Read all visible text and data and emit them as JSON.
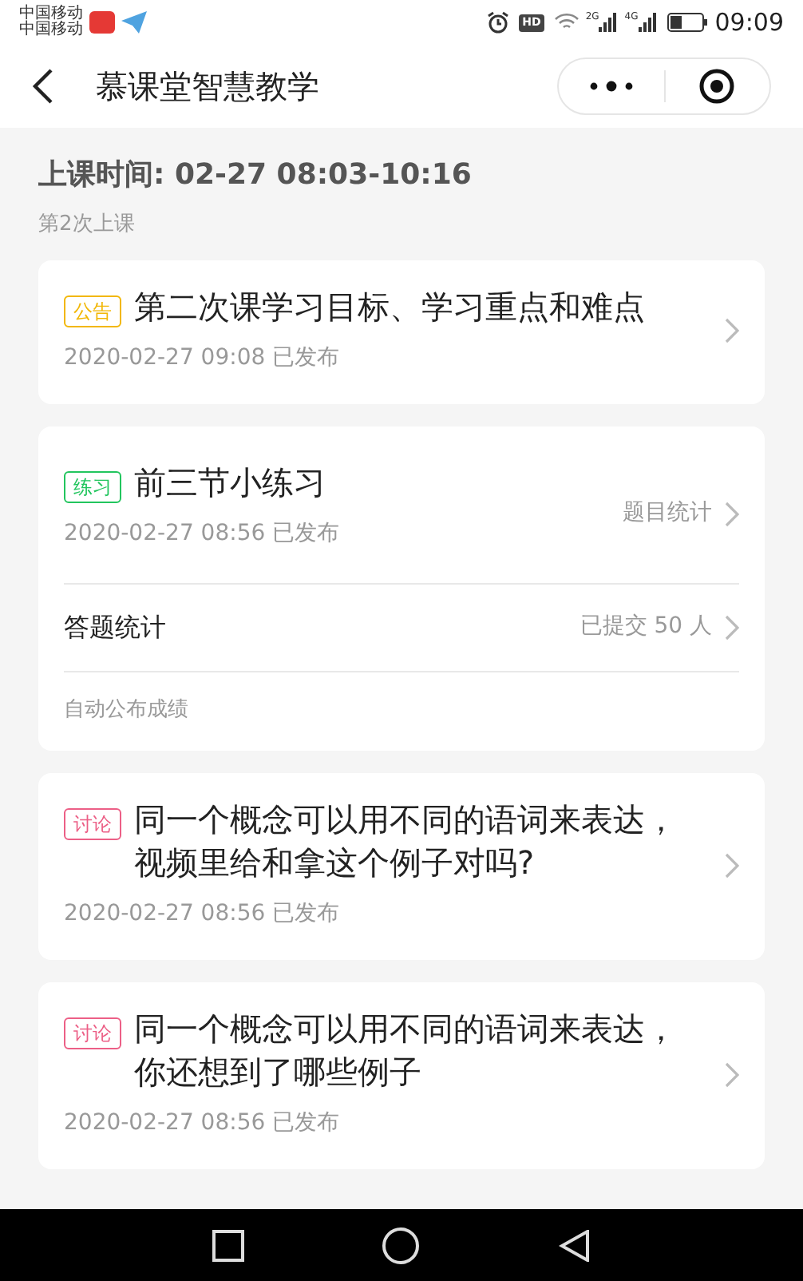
{
  "status_bar": {
    "carriers": [
      "中国移动",
      "中国移动"
    ],
    "hd": "HD",
    "networks": [
      "2G",
      "4G"
    ],
    "time": "09:09"
  },
  "header": {
    "title": "慕课堂智慧教学"
  },
  "session": {
    "time": "上课时间: 02-27 08:03-10:16",
    "count": "第2次上课"
  },
  "items": [
    {
      "kind": "post",
      "tag": "公告",
      "color": "#f2b705",
      "title": "第二次课学习目标、学习重点和难点",
      "date": "2020-02-27 09:08 已发布"
    },
    {
      "kind": "exercise",
      "tag": "练习",
      "color": "#22c55e",
      "title": "前三节小练习",
      "date": "2020-02-27 08:56 已发布",
      "link": "题目统计",
      "stats_label": "答题统计",
      "stats_value": "已提交 50 人",
      "note": "自动公布成绩"
    },
    {
      "kind": "post",
      "tag": "讨论",
      "color": "#ec5f86",
      "title": "同一个概念可以用不同的语词来表达，视频里给和拿这个例子对吗?",
      "date": "2020-02-27 08:56 已发布"
    },
    {
      "kind": "post",
      "tag": "讨论",
      "color": "#ec5f86",
      "title": "同一个概念可以用不同的语词来表达，你还想到了哪些例子",
      "date": "2020-02-27 08:56 已发布"
    }
  ]
}
